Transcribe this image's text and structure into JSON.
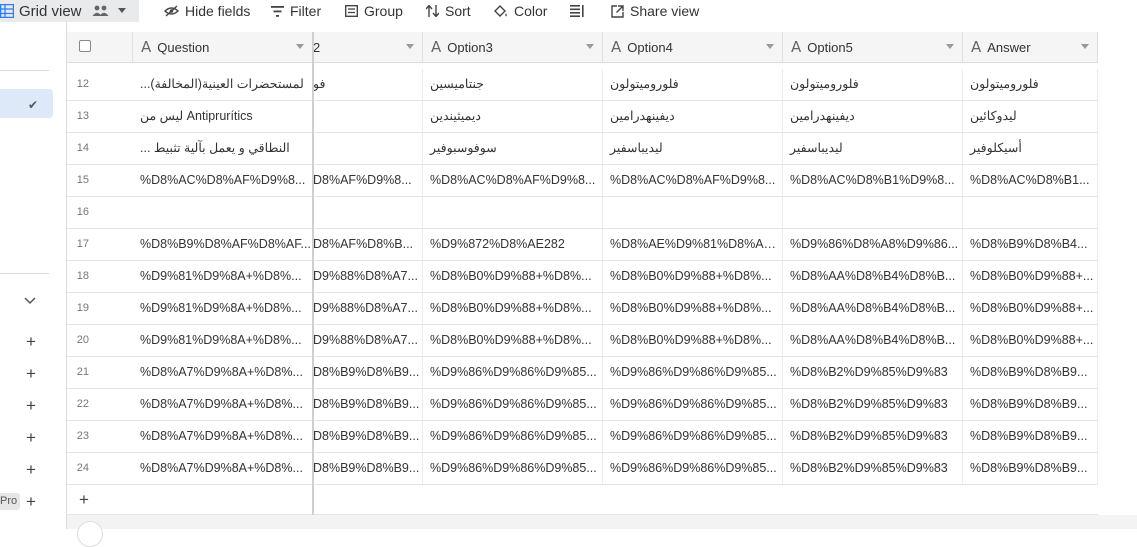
{
  "toolbar": {
    "view_name": "Grid view",
    "hide_fields": "Hide fields",
    "filter": "Filter",
    "group": "Group",
    "sort": "Sort",
    "color": "Color",
    "share_view": "Share view"
  },
  "sidebar": {
    "pro_badge": "Pro"
  },
  "grid": {
    "columns": [
      {
        "label": "Question"
      },
      {
        "label": "2"
      },
      {
        "label": "Option3"
      },
      {
        "label": "Option4"
      },
      {
        "label": "Option5"
      },
      {
        "label": "Answer"
      }
    ],
    "rows": [
      {
        "num": "12",
        "cells": [
          "...لمستحضرات العينية(المخالفة)",
          "فو",
          "جنتاميسين",
          "فلوروميتولون",
          "فلوروميتولون",
          "فلوروميتولون"
        ]
      },
      {
        "num": "13",
        "cells": [
          "ليس من Antiprurítics",
          "",
          "ديميثيندين",
          "ديفينهدرامين",
          "ديفينهدرامين",
          "ليدوكائين"
        ]
      },
      {
        "num": "14",
        "cells": [
          "... النطاقي و يعمل بآلية تثبيط",
          "",
          "سوفوسبوفير",
          "ليديباسفير",
          "ليديباسفير",
          "أسيكلوفير"
        ]
      },
      {
        "num": "15",
        "cells": [
          "%D8%AC%D8%AF%D9%8...",
          "D8%AF%D9%8...",
          "%D8%AC%D8%AF%D9%8...",
          "%D8%AC%D8%AF%D9%8...",
          "%D8%AC%D8%B1%D9%8...",
          "%D8%AC%D8%B1..."
        ]
      },
      {
        "num": "16",
        "cells": [
          "",
          "",
          "",
          "",
          "",
          ""
        ]
      },
      {
        "num": "17",
        "cells": [
          "%D8%B9%D8%AF%D8%AF...",
          "D8%AF%D8%B...",
          "%D9%872%D8%AE282",
          "%D8%AE%D9%81%D8%AE...",
          "%D9%86%D8%A8%D9%86...",
          "%D8%B9%D8%B4..."
        ]
      },
      {
        "num": "18",
        "cells": [
          "%D9%81%D9%8A+%D8%...",
          "D9%88%D8%A7...",
          "%D8%B0%D9%88+%D8%...",
          "%D8%B0%D9%88+%D8%...",
          "%D8%AA%D8%B4%D8%B...",
          "%D8%B0%D9%88+..."
        ]
      },
      {
        "num": "19",
        "cells": [
          "%D9%81%D9%8A+%D8%...",
          "D9%88%D8%A7...",
          "%D8%B0%D9%88+%D8%...",
          "%D8%B0%D9%88+%D8%...",
          "%D8%AA%D8%B4%D8%B...",
          "%D8%B0%D9%88+..."
        ]
      },
      {
        "num": "20",
        "cells": [
          "%D9%81%D9%8A+%D8%...",
          "D9%88%D8%A7...",
          "%D8%B0%D9%88+%D8%...",
          "%D8%B0%D9%88+%D8%...",
          "%D8%AA%D8%B4%D8%B...",
          "%D8%B0%D9%88+..."
        ]
      },
      {
        "num": "21",
        "cells": [
          "%D8%A7%D9%8A+%D8%...",
          "D8%B9%D8%B9...",
          "%D9%86%D9%86%D9%85...",
          "%D9%86%D9%86%D9%85...",
          "%D8%B2%D9%85%D9%83",
          "%D8%B9%D8%B9..."
        ]
      },
      {
        "num": "22",
        "cells": [
          "%D8%A7%D9%8A+%D8%...",
          "D8%B9%D8%B9...",
          "%D9%86%D9%86%D9%85...",
          "%D9%86%D9%86%D9%85...",
          "%D8%B2%D9%85%D9%83",
          "%D8%B9%D8%B9..."
        ]
      },
      {
        "num": "23",
        "cells": [
          "%D8%A7%D9%8A+%D8%...",
          "D8%B9%D8%B9...",
          "%D9%86%D9%86%D9%85...",
          "%D9%86%D9%86%D9%85...",
          "%D8%B2%D9%85%D9%83",
          "%D8%B9%D8%B9..."
        ]
      },
      {
        "num": "24",
        "cells": [
          "%D8%A7%D9%8A+%D8%...",
          "D8%B9%D8%B9...",
          "%D9%86%D9%86%D9%85...",
          "%D9%86%D9%86%D9%85...",
          "%D8%B2%D9%85%D9%83",
          "%D8%B9%D8%B9..."
        ]
      }
    ]
  },
  "colors": {
    "accent": "#2d7ff9",
    "selected_bg": "#dde8f8",
    "header_bg": "#f5f5f5"
  },
  "icons": [
    "grid-icon",
    "people-icon",
    "chevron-down-icon",
    "eye-slash-icon",
    "filter-icon",
    "group-icon",
    "sort-icon",
    "paint-bucket-icon",
    "row-height-icon",
    "share-icon",
    "checkmark-icon",
    "plus-icon",
    "text-field-icon"
  ]
}
